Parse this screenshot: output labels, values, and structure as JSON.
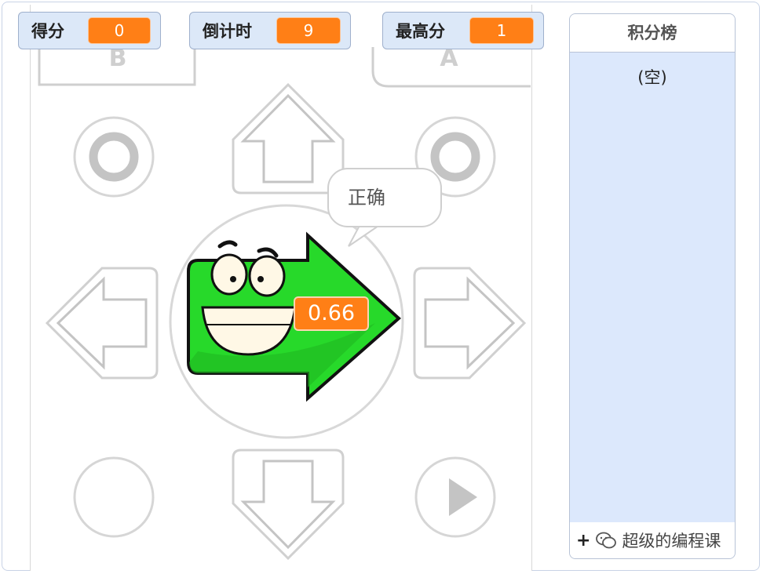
{
  "monitors": {
    "score": {
      "label": "得分",
      "value": "0"
    },
    "countdown": {
      "label": "倒计时",
      "value": "9"
    },
    "high_score": {
      "label": "最高分",
      "value": "1"
    }
  },
  "sprite": {
    "speech_bubble": "正确",
    "variable_readout": "0.66",
    "arrow_color": "#27d92a"
  },
  "gamepad": {
    "button_b_letter": "B",
    "button_a_letter": "A"
  },
  "list": {
    "title": "积分榜",
    "empty_text": "(空)",
    "add_label": "+",
    "watermark": "超级的编程课"
  },
  "colors": {
    "monitor_bg": "#dce8f8",
    "value_bg": "#ff7f16",
    "list_bg": "#dce8fc"
  }
}
